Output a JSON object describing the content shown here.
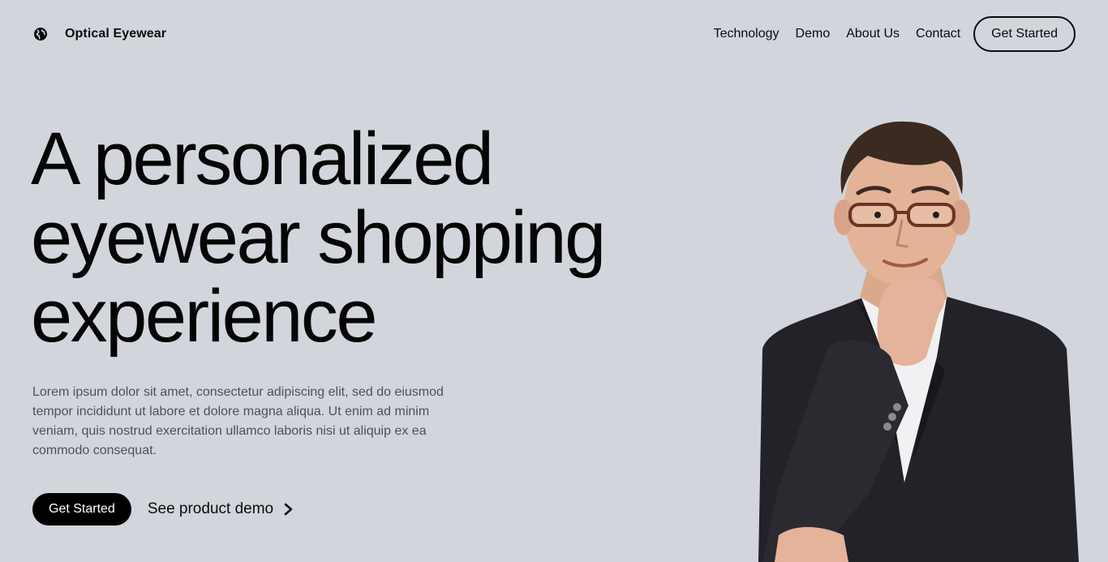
{
  "header": {
    "brand": {
      "name": "Optical Eyewear",
      "icon": "globe-icon"
    },
    "nav": [
      {
        "label": "Technology"
      },
      {
        "label": "Demo"
      },
      {
        "label": "About Us"
      },
      {
        "label": "Contact"
      }
    ],
    "cta_label": "Get Started"
  },
  "hero": {
    "title_lines": [
      "A personalized",
      "eyewear shopping",
      "experience"
    ],
    "body": "Lorem ipsum dolor sit amet, consectetur adipiscing elit, sed do eiusmod tempor incididunt ut labore et dolore magna aliqua. Ut enim ad minim veniam, quis nostrud exercitation ullamco laboris nisi ut aliquip ex ea commodo consequat.",
    "primary_cta": "Get Started",
    "secondary_cta": "See product demo",
    "secondary_icon": "chevron-right-icon",
    "image": "man-with-glasses-photo"
  },
  "colors": {
    "background": "#d2d6dc",
    "text": "#0b0b0b",
    "muted_text": "#4a5160",
    "button_bg": "#000000",
    "button_text": "#ffffff"
  }
}
